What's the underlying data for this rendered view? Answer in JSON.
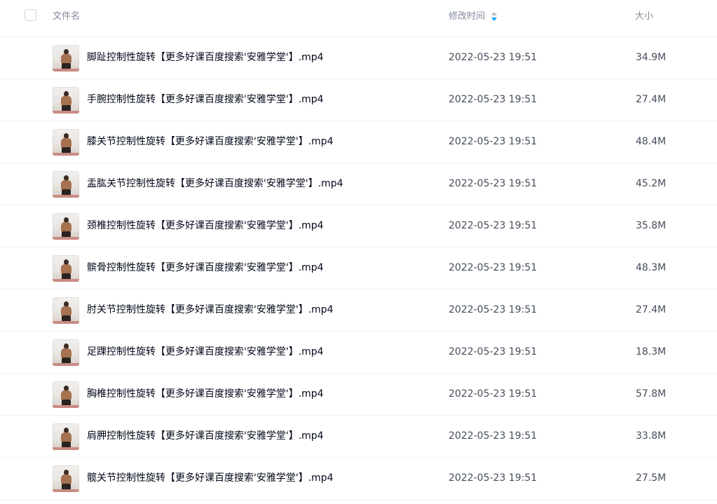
{
  "header": {
    "name_label": "文件名",
    "time_label": "修改时间",
    "size_label": "大小"
  },
  "colors": {
    "sort_active": "#06a7ff",
    "divider": "#eef0f4"
  },
  "files": [
    {
      "name": "脚趾控制性旋转【更多好课百度搜索'安雅学堂'】.mp4",
      "modified": "2022-05-23 19:51",
      "size": "34.9M"
    },
    {
      "name": "手腕控制性旋转【更多好课百度搜索'安雅学堂'】.mp4",
      "modified": "2022-05-23 19:51",
      "size": "27.4M"
    },
    {
      "name": "膝关节控制性旋转【更多好课百度搜索'安雅学堂'】.mp4",
      "modified": "2022-05-23 19:51",
      "size": "48.4M"
    },
    {
      "name": "盂肱关节控制性旋转【更多好课百度搜索'安雅学堂'】.mp4",
      "modified": "2022-05-23 19:51",
      "size": "45.2M"
    },
    {
      "name": "颈椎控制性旋转【更多好课百度搜索'安雅学堂'】.mp4",
      "modified": "2022-05-23 19:51",
      "size": "35.8M"
    },
    {
      "name": "髌骨控制性旋转【更多好课百度搜索'安雅学堂'】.mp4",
      "modified": "2022-05-23 19:51",
      "size": "48.3M"
    },
    {
      "name": "肘关节控制性旋转【更多好课百度搜索'安雅学堂'】.mp4",
      "modified": "2022-05-23 19:51",
      "size": "27.4M"
    },
    {
      "name": "足踝控制性旋转【更多好课百度搜索'安雅学堂'】.mp4",
      "modified": "2022-05-23 19:51",
      "size": "18.3M"
    },
    {
      "name": "胸椎控制性旋转【更多好课百度搜索'安雅学堂'】.mp4",
      "modified": "2022-05-23 19:51",
      "size": "57.8M"
    },
    {
      "name": "肩胛控制性旋转【更多好课百度搜索'安雅学堂'】.mp4",
      "modified": "2022-05-23 19:51",
      "size": "33.8M"
    },
    {
      "name": "髋关节控制性旋转【更多好课百度搜索'安雅学堂'】.mp4",
      "modified": "2022-05-23 19:51",
      "size": "27.5M"
    }
  ]
}
